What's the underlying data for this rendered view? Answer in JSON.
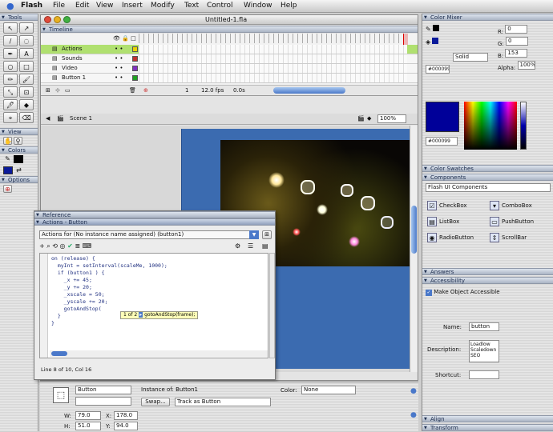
{
  "menubar": {
    "apple": "",
    "app": "Flash",
    "items": [
      "File",
      "Edit",
      "View",
      "Insert",
      "Modify",
      "Text",
      "Control",
      "Window",
      "Help"
    ]
  },
  "document": {
    "title": "Untitled-1.fla"
  },
  "timeline": {
    "label": "Timeline",
    "layers": [
      {
        "name": "Actions",
        "color": "#e8d200",
        "selected": true
      },
      {
        "name": "Sounds",
        "color": "#c23030",
        "selected": false
      },
      {
        "name": "Video",
        "color": "#8030c0",
        "selected": false
      },
      {
        "name": "Button 1",
        "color": "#20a020",
        "selected": false
      }
    ],
    "fps": "12.0 fps",
    "time": "0.0s",
    "frame": "1"
  },
  "editbar": {
    "scene": "Scene 1",
    "zoom": "100%"
  },
  "tools": {
    "label": "Tools",
    "view_label": "View",
    "colors_label": "Colors",
    "options_label": "Options",
    "icons": [
      "arrow-icon",
      "subselect-icon",
      "line-icon",
      "lasso-icon",
      "pen-icon",
      "text-icon",
      "oval-icon",
      "rect-icon",
      "pencil-icon",
      "brush-icon",
      "freetransform-icon",
      "fill-transform-icon",
      "ink-bottle-icon",
      "paint-bucket-icon",
      "eyedropper-icon",
      "eraser-icon",
      "hand-icon",
      "zoom-icon",
      "stroke-color-icon",
      "fill-color-icon"
    ]
  },
  "actions_panel": {
    "reference_label": "Reference",
    "title": "Actions - Button",
    "dropdown": "Actions for (No instance name assigned) (button1)",
    "code": [
      "on (release) {",
      "  myInt = setInterval(scaleMe, 1000);",
      "  if (button1 ) {",
      "    _x += 45;",
      "    _y += 20;",
      "    _xscale = 50;",
      "    _yscale += 20;",
      "    gotoAndStop(",
      "  }",
      "}"
    ],
    "hint_text": "1 of 2",
    "hint_code": "gotoAndStop(frame);",
    "status": "Line 8 of 10, Col 16"
  },
  "properties": {
    "symbol_type": "Button",
    "instance_of": "Instance of: Button1",
    "swap_label": "Swap...",
    "track": "Track as Button",
    "color_label": "Color:",
    "color_value": "None",
    "w_label": "W:",
    "w_value": "79.0",
    "x_label": "X:",
    "x_value": "178.0",
    "h_label": "H:",
    "h_value": "51.0",
    "y_label": "Y:",
    "y_value": "94.0"
  },
  "color_mixer": {
    "label": "Color Mixer",
    "r": "0",
    "g": "0",
    "b": "153",
    "alpha": "100%",
    "type": "Solid",
    "hex": "#000099"
  },
  "swatches_label": "Color Swatches",
  "components": {
    "label": "Components",
    "dropdown": "Flash UI Components",
    "items": [
      "CheckBox",
      "ComboBox",
      "ListBox",
      "PushButton",
      "RadioButton",
      "ScrollBar"
    ]
  },
  "answers_label": "Answers",
  "accessibility": {
    "label": "Accessibility",
    "make_accessible": "Make Object Accessible",
    "name_label": "Name:",
    "name_value": "button",
    "desc_label": "Description:",
    "desc_value": "Loadlow Scaledown SEO",
    "shortcut_label": "Shortcut:"
  },
  "align_label": "Align",
  "transform_label": "Transform",
  "colors": {
    "accent": "#4a78c9",
    "stage_bg": "#3b6bb0",
    "timeline_sel": "#b0e070"
  }
}
